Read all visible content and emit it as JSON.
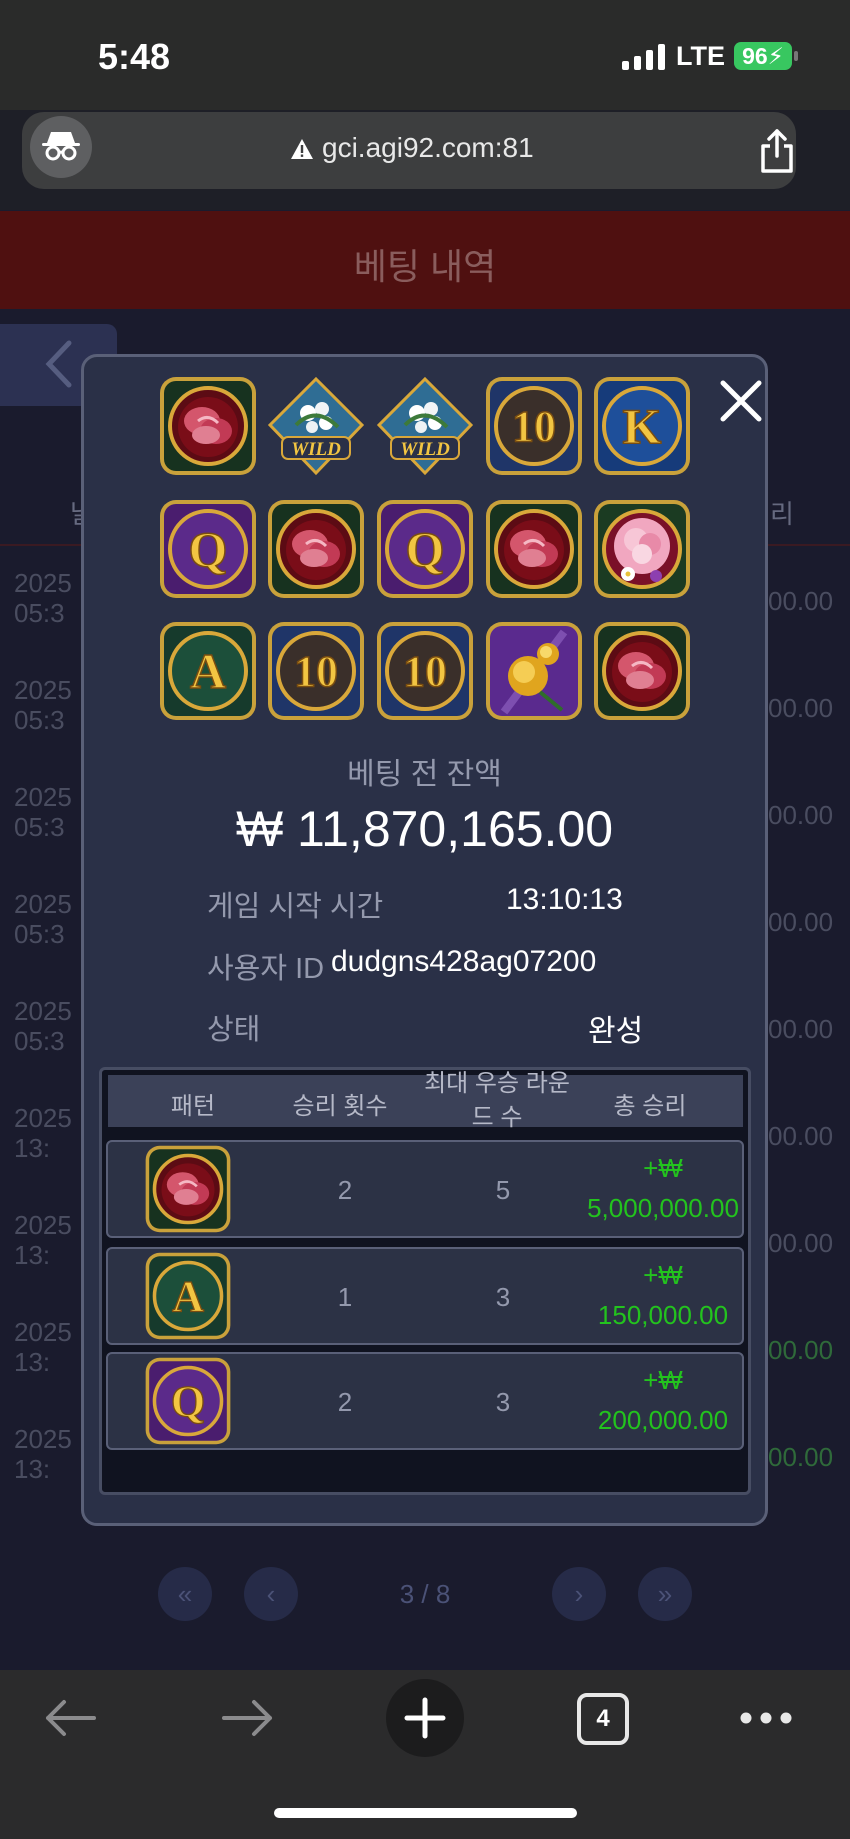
{
  "status_bar": {
    "time": "5:48",
    "network": "LTE",
    "battery": "96"
  },
  "browser": {
    "url": "gci.agi92.com:81",
    "tab_count": "4"
  },
  "page": {
    "title": "베팅 내역",
    "col_left": "날",
    "col_right": "리",
    "rows": [
      {
        "date1": "2025",
        "date2": "05:3",
        "amount": "00.00",
        "green": false
      },
      {
        "date1": "2025",
        "date2": "05:3",
        "amount": "00.00",
        "green": false
      },
      {
        "date1": "2025",
        "date2": "05:3",
        "amount": "00.00",
        "green": false
      },
      {
        "date1": "2025",
        "date2": "05:3",
        "amount": "00.00",
        "green": false
      },
      {
        "date1": "2025",
        "date2": "05:3",
        "amount": "00.00",
        "green": false
      },
      {
        "date1": "2025",
        "date2": "13:",
        "amount": "00.00",
        "green": false
      },
      {
        "date1": "2025",
        "date2": "13:",
        "amount": "00.00",
        "green": false
      },
      {
        "date1": "2025",
        "date2": "13:",
        "amount": "00.00",
        "green": true
      },
      {
        "date1": "2025",
        "date2": "13:",
        "amount": "00.00",
        "green": true
      }
    ],
    "pagination": {
      "first": "«",
      "prev": "‹",
      "text": "3 / 8",
      "next": "›",
      "last": "»"
    }
  },
  "modal": {
    "reels": [
      [
        "rose-red",
        "wild",
        "wild",
        "ten",
        "king"
      ],
      [
        "queen",
        "rose-red",
        "queen",
        "rose-red",
        "peony"
      ],
      [
        "ace",
        "ten",
        "ten",
        "rose-gold",
        "rose-red"
      ]
    ],
    "symbols": {
      "wild_text": "WILD",
      "ten_text": "10",
      "king_text": "K",
      "queen_text": "Q",
      "ace_text": "A"
    },
    "balance_label": "베팅 전 잔액",
    "balance": "₩ 11,870,165.00",
    "start_time_label": "게임 시작 시간",
    "start_time": "13:10:13",
    "user_id_label": "사용자 ID",
    "user_id": "dudgns428ag07200",
    "status_label": "상태",
    "status": "완성",
    "table": {
      "headers": [
        "패턴",
        "승리 횟수",
        "최대 우승 라운드 수",
        "총 승리"
      ],
      "header_round_line1": "최대 우승 라운",
      "header_round_line2": "드 수",
      "rows": [
        {
          "symbol": "rose-red",
          "wins": "2",
          "rounds": "5",
          "currency": "+₩",
          "total": "5,000,000.00"
        },
        {
          "symbol": "ace",
          "wins": "1",
          "rounds": "3",
          "currency": "+₩",
          "total": "150,000.00"
        },
        {
          "symbol": "queen",
          "wins": "2",
          "rounds": "3",
          "currency": "+₩",
          "total": "200,000.00"
        }
      ]
    }
  },
  "icons": [
    "incognito-icon",
    "warning-icon",
    "share-icon",
    "back-arrow-icon",
    "forward-arrow-icon",
    "new-tab-icon",
    "tabs-icon",
    "more-icon",
    "close-icon"
  ],
  "colors": {
    "header": "#4f1010",
    "modal_bg": "#2a3047",
    "win_green": "#23c31e",
    "battery": "#38c760"
  }
}
